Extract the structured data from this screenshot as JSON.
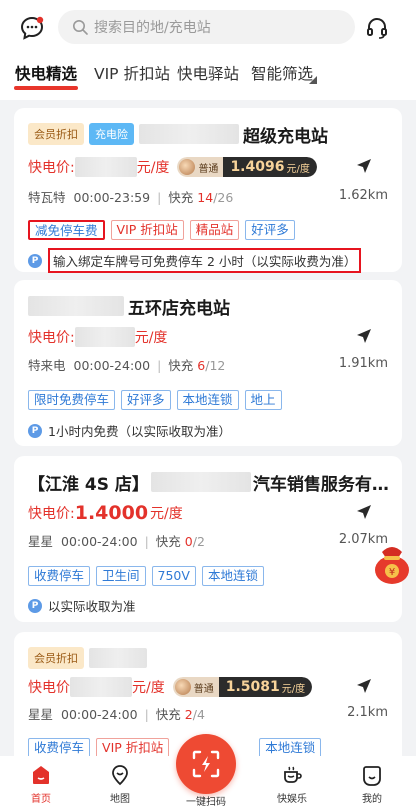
{
  "search": {
    "placeholder": "搜索目的地/充电站"
  },
  "tabs": [
    "快电精选",
    "VIP 折扣站",
    "快电驿站",
    "智能筛选"
  ],
  "cards": [
    {
      "badges": [
        "会员折扣",
        "充电险"
      ],
      "title": "超级充电站",
      "price_label": "快电价:",
      "price_unit": "元/度",
      "member_label": "普通",
      "member_price": "1.4096",
      "member_unit": "元/度",
      "operator": "特瓦特",
      "hours": "00:00-23:59",
      "fast_label": "快充",
      "fast_free": "14",
      "fast_total": "/26",
      "distance": "1.62km",
      "tags": [
        "减免停车费",
        "VIP 折扣站",
        "精品站",
        "好评多"
      ],
      "note": "输入绑定车牌号可免费停车 2 小时（以实际收费为准）"
    },
    {
      "title": "五环店充电站",
      "price_label": "快电价:",
      "price_unit": "元/度",
      "operator": "特来电",
      "hours": "00:00-24:00",
      "fast_label": "快充",
      "fast_free": "6",
      "fast_total": "/12",
      "distance": "1.91km",
      "tags": [
        "限时免费停车",
        "好评多",
        "本地连锁",
        "地上"
      ],
      "note": "1小时内免费（以实际收取为准）"
    },
    {
      "title_prefix": "【江淮 4S 店】",
      "title_suffix": "汽车销售服务有…",
      "price_label": "快电价:",
      "price_value": "1.4000",
      "price_unit": "元/度",
      "operator": "星星",
      "hours": "00:00-24:00",
      "fast_label": "快充",
      "fast_free": "0",
      "fast_total": "/2",
      "distance": "2.07km",
      "tags": [
        "收费停车",
        "卫生间",
        "750V",
        "本地连锁"
      ],
      "note": "以实际收取为准"
    },
    {
      "badges": [
        "会员折扣"
      ],
      "price_label": "快电价",
      "price_unit": "元/度",
      "member_label": "普通",
      "member_price": "1.5081",
      "member_unit": "元/度",
      "operator": "星星",
      "hours": "00:00-24:00",
      "fast_label": "快充",
      "fast_free": "2",
      "fast_total": "/4",
      "distance": "2.1km",
      "tags": [
        "收费停车",
        "VIP 折扣站",
        "本地连锁"
      ]
    }
  ],
  "bottom_nav": [
    "首页",
    "地图",
    "一键扫码",
    "快娱乐",
    "我的"
  ],
  "colors": {
    "accent": "#e3322b",
    "tag_blue": "#2f7ad6",
    "scan_button": "#ee4a33"
  }
}
